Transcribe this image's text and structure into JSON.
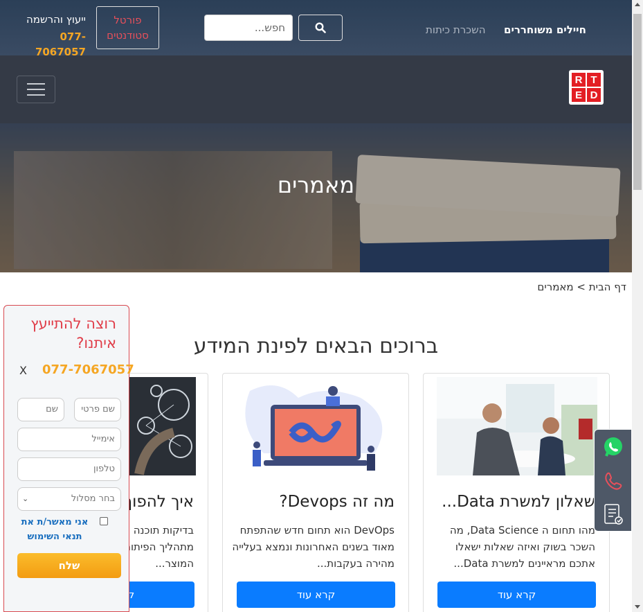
{
  "topbar": {
    "consult_label": "ייעוץ והרשמה",
    "consult_phone": "077-7067057",
    "portal_line1": "פורטל",
    "portal_line2": "סטודנטים",
    "search_placeholder": "חפש...",
    "nav_soldiers": "חיילים משוחררים",
    "nav_rent": "השכרת כיתות"
  },
  "logo": [
    "R",
    "T",
    "E",
    "D"
  ],
  "hero": {
    "title": "מאמרים"
  },
  "breadcrumb": {
    "home": "דף הבית",
    "separator": ">",
    "current": "מאמרים"
  },
  "section_title": "ברוכים הבאים לפינת המידע",
  "cards": [
    {
      "title": "שאלון למשרת Data...",
      "text": "מהו תחום ה Data Science, מה השכר בשוק ואיזה שאלות ישאלו אתכם מראיינים למשרת Data...",
      "button": "קרא עוד"
    },
    {
      "title": "מה זה Devops?",
      "text": "DevOps הוא תחום חדש שהתפתח מאוד בשנים האחרונות ונמצא בעלייה מהירה בעקבות...",
      "button": "קרא עוד"
    },
    {
      "title": "איך להפוך לבודק תוכנה",
      "text": "בדיקות תוכנה הן חלק אינטגרלי מתהליך הפיתוח ואבטחת איכות המוצר...",
      "button": "קרא עוד"
    }
  ],
  "form": {
    "title": "רוצה להתייעץ איתנו?",
    "phone": "077-7067057",
    "close": "X",
    "first_name": "שם פרטי",
    "last_name": "שם משפחה",
    "email": "אימייל",
    "phone_field": "טלפון",
    "track": "בחר מסלול",
    "consent": "אני מאשר/ת את תנאי השימוש",
    "send": "שלח"
  },
  "colors": {
    "accent": "#0a7cff",
    "brand_red": "#e31e24",
    "phone_orange": "#f5a623"
  },
  "icons": [
    "search-icon",
    "whatsapp-icon",
    "phone-icon",
    "form-icon"
  ]
}
